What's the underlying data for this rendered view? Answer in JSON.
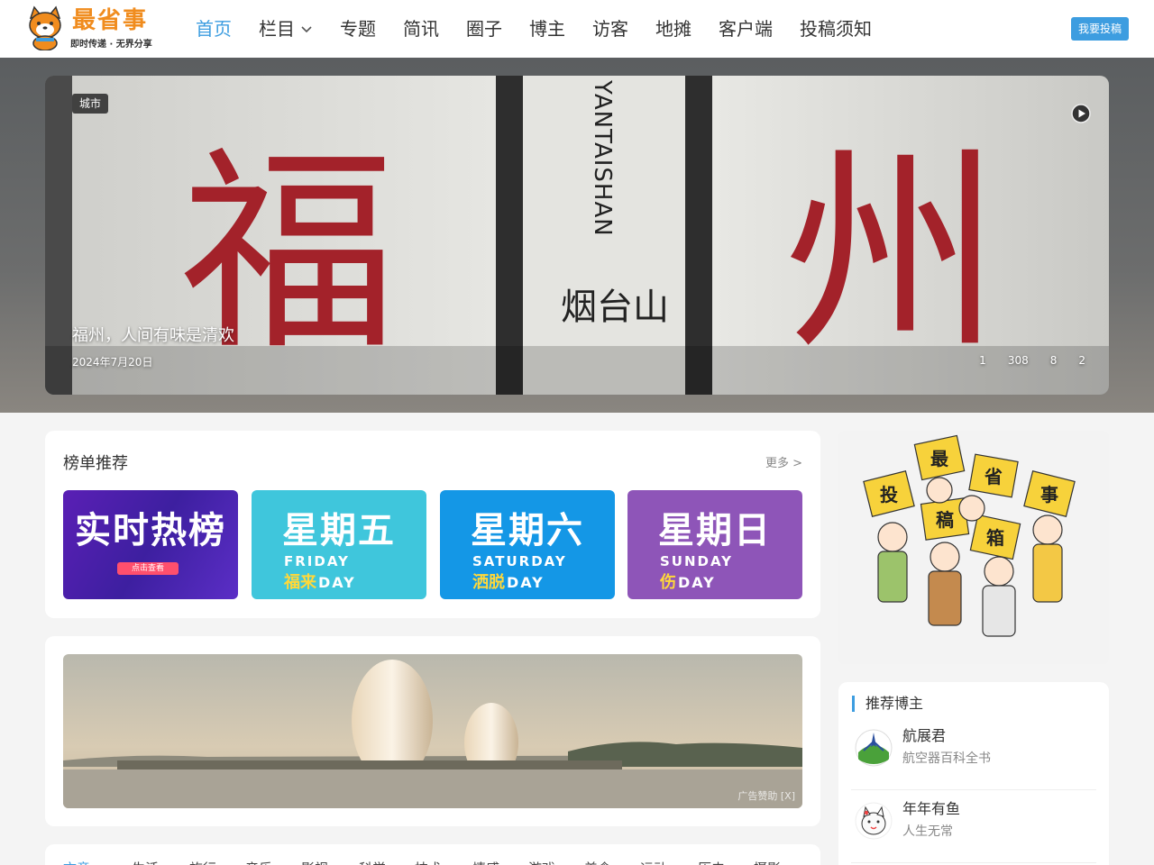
{
  "header": {
    "logo_title": "最省事",
    "logo_tagline": "即时传递 · 无界分享",
    "nav": [
      {
        "label": "首页",
        "active": true
      },
      {
        "label": "栏目",
        "dropdown": true
      },
      {
        "label": "专题"
      },
      {
        "label": "简讯"
      },
      {
        "label": "圈子"
      },
      {
        "label": "博主"
      },
      {
        "label": "访客"
      },
      {
        "label": "地摊"
      },
      {
        "label": "客户端"
      },
      {
        "label": "投稿须知"
      }
    ],
    "submit_label": "我要投稿"
  },
  "hero": {
    "badge": "城市",
    "title": "福州，人间有味是清欢",
    "date": "2024年7月20日",
    "stats": [
      "1",
      "308",
      "8",
      "2"
    ],
    "sign": {
      "char_left": "福",
      "char_right": "州",
      "pinyin": "YANTAISHAN",
      "place": "烟台山"
    }
  },
  "rank": {
    "title": "榜单推荐",
    "more": "更多 >",
    "tiles": [
      {
        "big": "实时热榜",
        "pill": "点击查看"
      },
      {
        "big": "星期五",
        "en": "FRIDAY",
        "zh": "福来",
        "day": "DAY"
      },
      {
        "big": "星期六",
        "en": "SATURDAY",
        "zh": "洒脱",
        "day": "DAY"
      },
      {
        "big": "星期日",
        "en": "SUNDAY",
        "zh": "伤",
        "day": "DAY"
      }
    ]
  },
  "ad": {
    "label": "广告赞助 [X]"
  },
  "tabs": [
    "文章",
    "生活",
    "旅行",
    "音乐",
    "影视",
    "科学",
    "技术",
    "情感",
    "游戏",
    "美食",
    "运动",
    "历史",
    "摄影"
  ],
  "sidebar": {
    "illus_signs": [
      "投",
      "稿",
      "箱",
      "最",
      "省",
      "事"
    ],
    "blogger_title": "推荐博主",
    "bloggers": [
      {
        "name": "航展君",
        "desc": "航空器百科全书"
      },
      {
        "name": "年年有鱼",
        "desc": "人生无常"
      }
    ]
  },
  "colors": {
    "accent": "#3d9de0",
    "logo_orange": "#f08c1e",
    "sign_red": "#a3222a"
  }
}
